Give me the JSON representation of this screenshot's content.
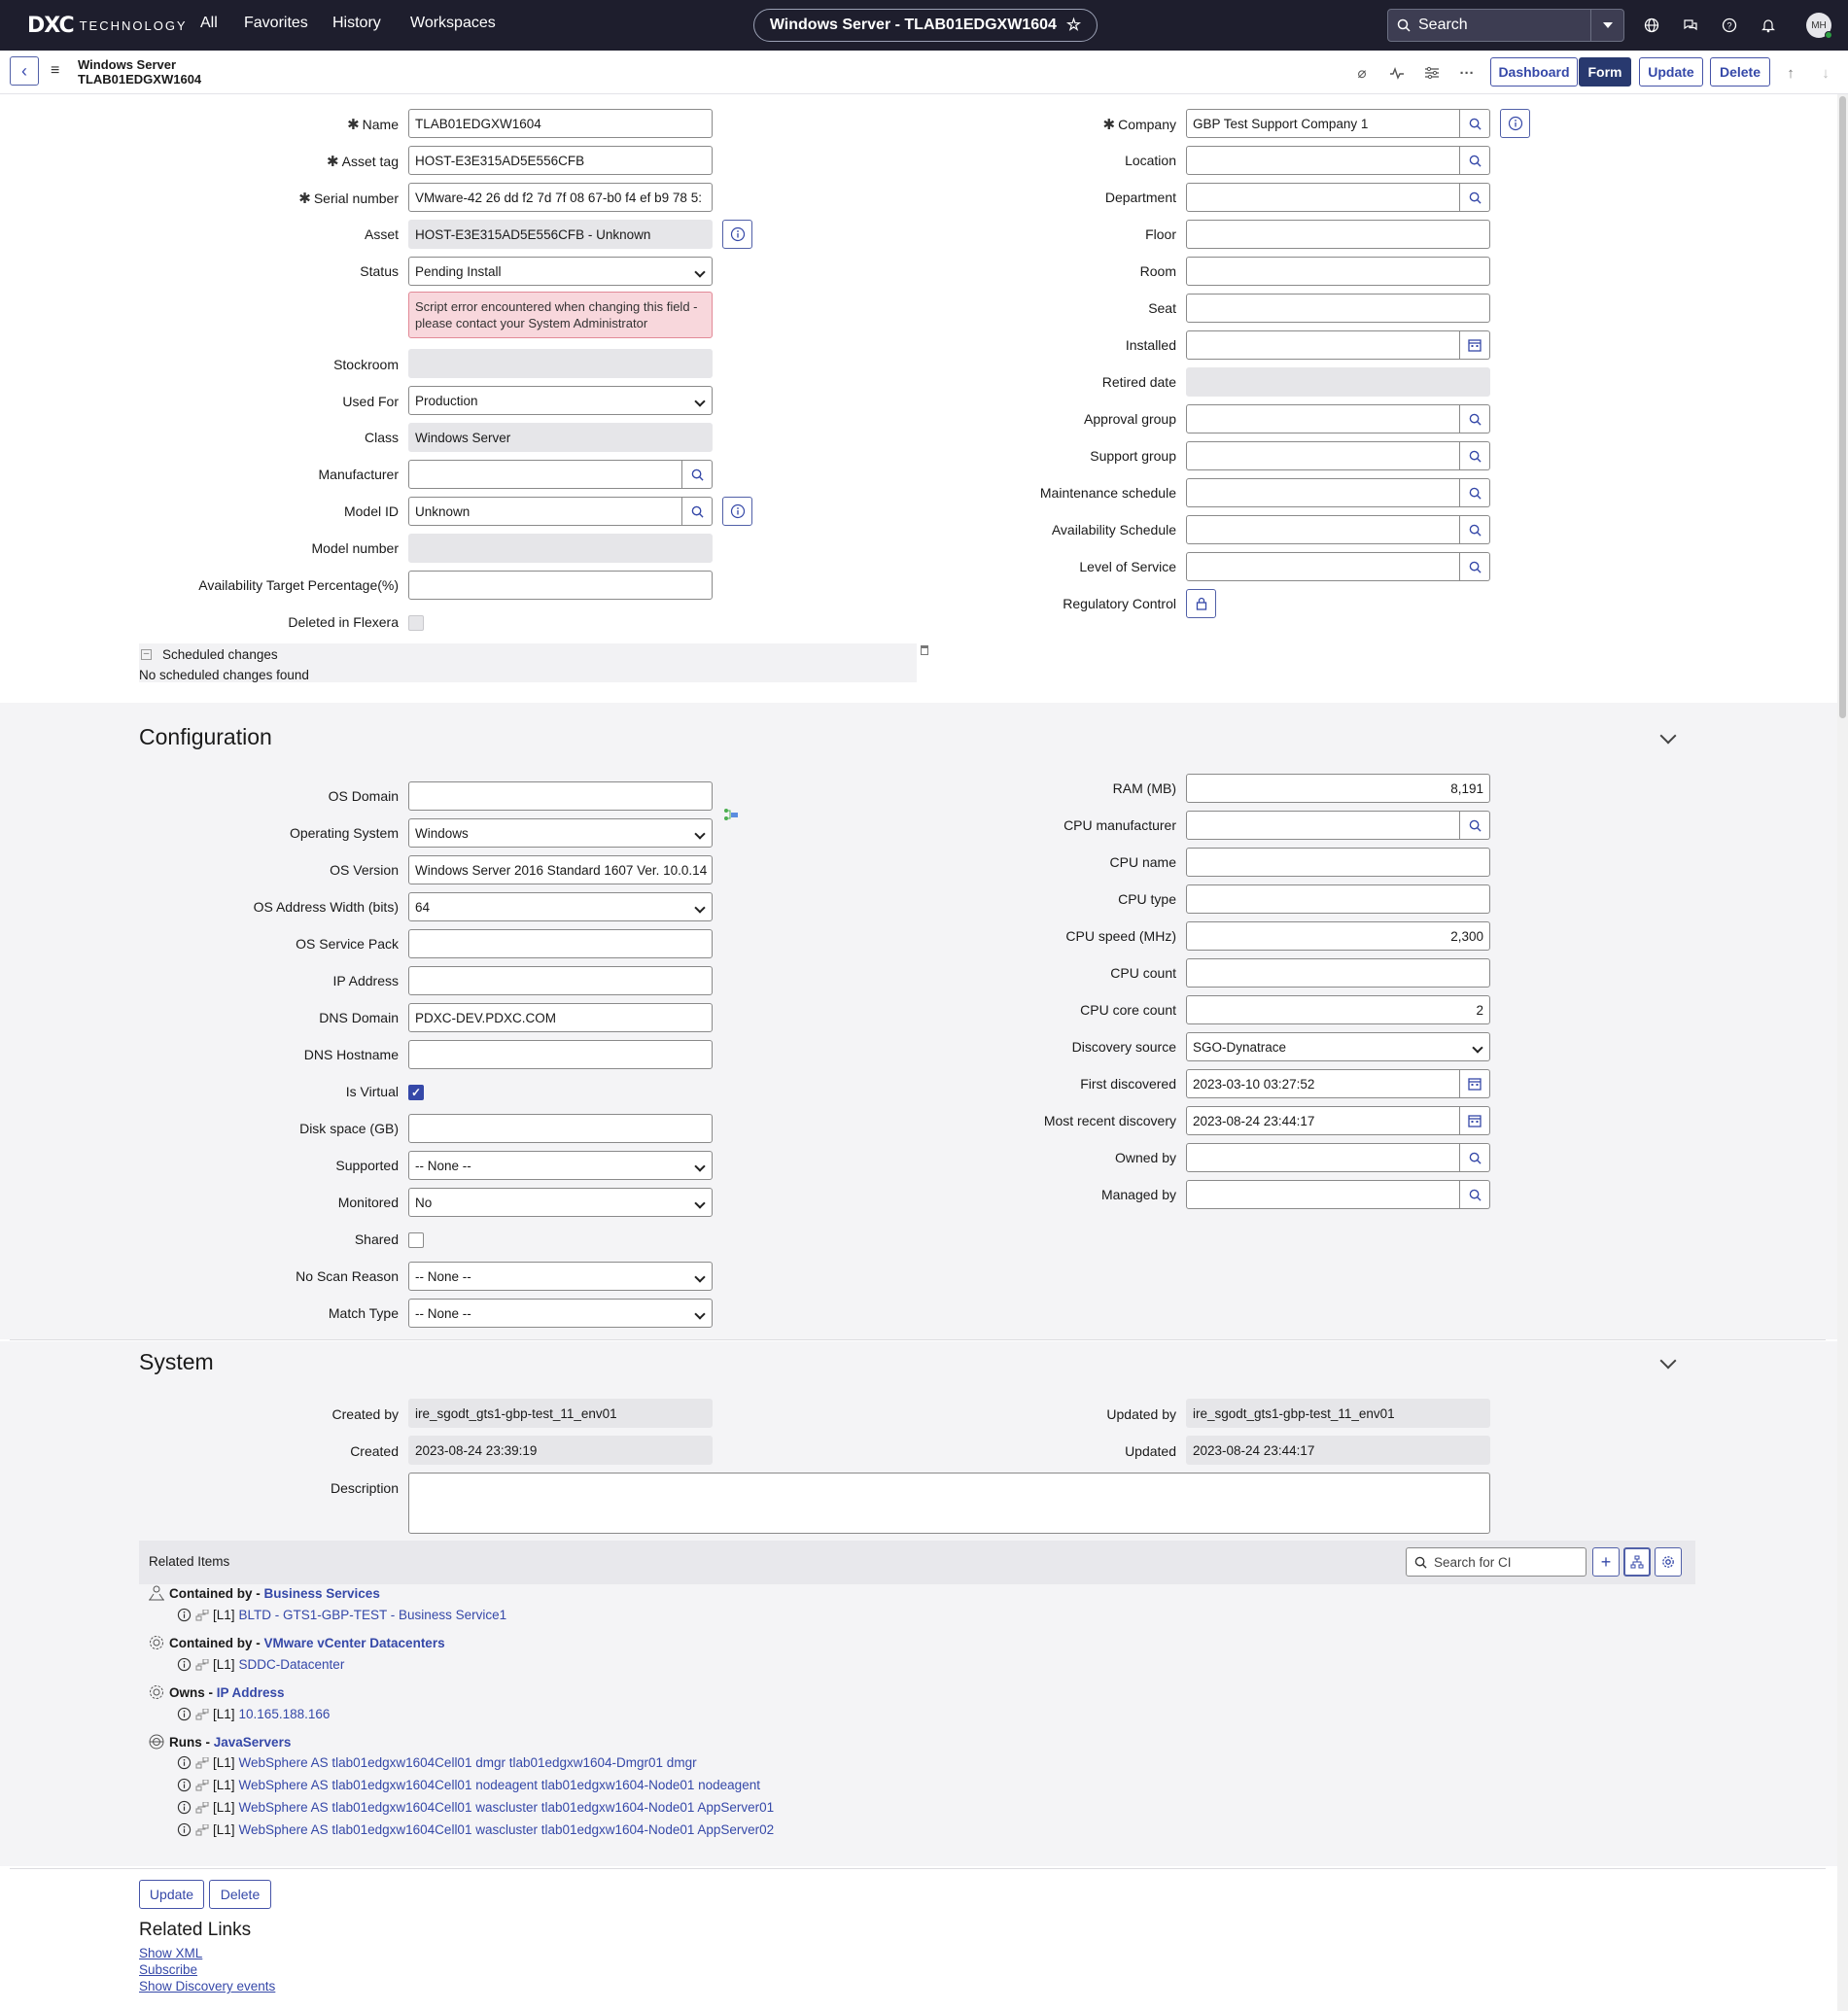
{
  "topnav": {
    "brand_mark": "DXC",
    "brand_text": "TECHNOLOGY",
    "links": [
      "All",
      "Favorites",
      "History",
      "Workspaces"
    ],
    "record_title": "Windows Server - TLAB01EDGXW1604",
    "search_label": "Search",
    "avatar_initials": "MH"
  },
  "header": {
    "record_type": "Windows Server",
    "record_name": "TLAB01EDGXW1604",
    "buttons": {
      "dashboard": "Dashboard",
      "form": "Form",
      "update": "Update",
      "delete": "Delete"
    }
  },
  "left_fields": {
    "name": {
      "label": "Name",
      "value": "TLAB01EDGXW1604"
    },
    "asset_tag": {
      "label": "Asset tag",
      "value": "HOST-E3E315AD5E556CFB"
    },
    "serial_number": {
      "label": "Serial number",
      "value": "VMware-42 26 dd f2 7d 7f 08 67-b0 f4 ef b9 78 5:"
    },
    "asset": {
      "label": "Asset",
      "value": "HOST-E3E315AD5E556CFB - Unknown"
    },
    "status": {
      "label": "Status",
      "value": "Pending Install"
    },
    "status_error": "Script error encountered when changing this field - please contact your System Administrator",
    "stockroom": {
      "label": "Stockroom",
      "value": ""
    },
    "used_for": {
      "label": "Used For",
      "value": "Production"
    },
    "class": {
      "label": "Class",
      "value": "Windows Server"
    },
    "manufacturer": {
      "label": "Manufacturer",
      "value": ""
    },
    "model_id": {
      "label": "Model ID",
      "value": "Unknown"
    },
    "model_number": {
      "label": "Model number",
      "value": ""
    },
    "availability_target": {
      "label": "Availability Target Percentage(%)",
      "value": ""
    },
    "deleted_in_flexera": {
      "label": "Deleted in Flexera"
    }
  },
  "right_fields": {
    "company": {
      "label": "Company",
      "value": "GBP Test Support Company 1"
    },
    "location": {
      "label": "Location",
      "value": ""
    },
    "department": {
      "label": "Department",
      "value": ""
    },
    "floor": {
      "label": "Floor",
      "value": ""
    },
    "room": {
      "label": "Room",
      "value": ""
    },
    "seat": {
      "label": "Seat",
      "value": ""
    },
    "installed": {
      "label": "Installed",
      "value": ""
    },
    "retired_date": {
      "label": "Retired date",
      "value": ""
    },
    "approval_group": {
      "label": "Approval group",
      "value": ""
    },
    "support_group": {
      "label": "Support group",
      "value": ""
    },
    "maintenance_schedule": {
      "label": "Maintenance schedule",
      "value": ""
    },
    "availability_schedule": {
      "label": "Availability Schedule",
      "value": ""
    },
    "level_of_service": {
      "label": "Level of Service",
      "value": ""
    },
    "regulatory_control": {
      "label": "Regulatory Control"
    }
  },
  "scheduled_changes": {
    "title": "Scheduled changes",
    "empty": "No scheduled changes found"
  },
  "configuration": {
    "title": "Configuration",
    "left": [
      {
        "label": "OS Domain",
        "value": ""
      },
      {
        "label": "Operating System",
        "value": "Windows"
      },
      {
        "label": "OS Version",
        "value": "Windows Server 2016 Standard 1607 Ver. 10.0.14"
      },
      {
        "label": "OS Address Width (bits)",
        "value": "64"
      },
      {
        "label": "OS Service Pack",
        "value": ""
      },
      {
        "label": "IP Address",
        "value": ""
      },
      {
        "label": "DNS Domain",
        "value": "PDXC-DEV.PDXC.COM"
      },
      {
        "label": "DNS Hostname",
        "value": ""
      },
      {
        "label": "Is Virtual",
        "value": "true"
      },
      {
        "label": "Disk space (GB)",
        "value": ""
      },
      {
        "label": "Supported",
        "value": "-- None --"
      },
      {
        "label": "Monitored",
        "value": "No"
      },
      {
        "label": "Shared",
        "value": "false"
      },
      {
        "label": "No Scan Reason",
        "value": "-- None --"
      },
      {
        "label": "Match Type",
        "value": "-- None --"
      }
    ],
    "right": [
      {
        "label": "RAM (MB)",
        "value": "8,191"
      },
      {
        "label": "CPU manufacturer",
        "value": ""
      },
      {
        "label": "CPU name",
        "value": ""
      },
      {
        "label": "CPU type",
        "value": ""
      },
      {
        "label": "CPU speed (MHz)",
        "value": "2,300"
      },
      {
        "label": "CPU count",
        "value": ""
      },
      {
        "label": "CPU core count",
        "value": "2"
      },
      {
        "label": "Discovery source",
        "value": "SGO-Dynatrace"
      },
      {
        "label": "First discovered",
        "value": "2023-03-10 03:27:52"
      },
      {
        "label": "Most recent discovery",
        "value": "2023-08-24 23:44:17"
      },
      {
        "label": "Owned by",
        "value": ""
      },
      {
        "label": "Managed by",
        "value": ""
      }
    ]
  },
  "system": {
    "title": "System",
    "created_by": {
      "label": "Created by",
      "value": "ire_sgodt_gts1-gbp-test_11_env01"
    },
    "created": {
      "label": "Created",
      "value": "2023-08-24 23:39:19"
    },
    "updated_by": {
      "label": "Updated by",
      "value": "ire_sgodt_gts1-gbp-test_11_env01"
    },
    "updated": {
      "label": "Updated",
      "value": "2023-08-24 23:44:17"
    },
    "description": {
      "label": "Description",
      "value": ""
    }
  },
  "related_items": {
    "title": "Related Items",
    "search_placeholder": "Search for CI",
    "groups": [
      {
        "rel": "Contained by - ",
        "type": "Business Services",
        "items": [
          "BLTD - GTS1-GBP-TEST - Business Service1"
        ]
      },
      {
        "rel": "Contained by - ",
        "type": "VMware vCenter Datacenters",
        "items": [
          "SDDC-Datacenter"
        ]
      },
      {
        "rel": "Owns - ",
        "type": "IP Address",
        "items": [
          "10.165.188.166"
        ]
      },
      {
        "rel": "Runs - ",
        "type": "JavaServers",
        "items": [
          "WebSphere AS tlab01edgxw1604Cell01 dmgr tlab01edgxw1604-Dmgr01 dmgr",
          "WebSphere AS tlab01edgxw1604Cell01 nodeagent tlab01edgxw1604-Node01 nodeagent",
          "WebSphere AS tlab01edgxw1604Cell01 wascluster tlab01edgxw1604-Node01 AppServer01",
          "WebSphere AS tlab01edgxw1604Cell01 wascluster tlab01edgxw1604-Node01 AppServer02"
        ]
      }
    ],
    "level_tag": "[L1]"
  },
  "footer": {
    "update": "Update",
    "delete": "Delete",
    "related_links_title": "Related Links",
    "links": [
      "Show XML",
      "Subscribe",
      "Show Discovery events"
    ]
  },
  "colors": {
    "nav_bg": "#1e1e2d",
    "accent": "#3548a8",
    "error_bg": "#f8d7dc"
  }
}
